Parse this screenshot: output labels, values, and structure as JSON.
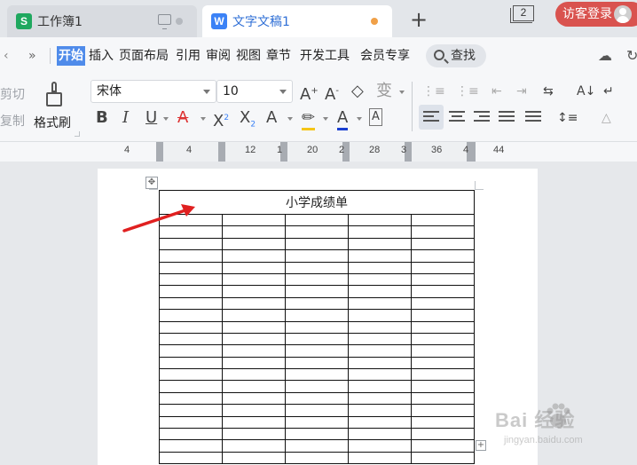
{
  "tabs": [
    {
      "label": "工作簿1",
      "logo": "S"
    },
    {
      "label": "文字文稿1",
      "logo": "W"
    }
  ],
  "new_tab_label": "+",
  "window_badge": "2",
  "guest_label": "访客登录",
  "menu": {
    "overflow": "»",
    "items": [
      "开始",
      "插入",
      "页面布局",
      "引用",
      "审阅",
      "视图",
      "章节",
      "开发工具",
      "会员专享"
    ],
    "search_label": "查找"
  },
  "clipboard": {
    "cut": "剪切",
    "copy": "复制",
    "format_painter": "格式刷"
  },
  "font": {
    "family": "宋体",
    "size": "10"
  },
  "ruler": {
    "numbers": [
      "4",
      "4",
      "12",
      "1",
      "20",
      "2",
      "28",
      "3",
      "36",
      "4",
      "44"
    ]
  },
  "table": {
    "title": "小学成绩单",
    "columns": 5,
    "rows": 21
  },
  "watermark": {
    "brand": "Bai  经验",
    "url": "jingyan.baidu.com"
  },
  "colors": {
    "accent": "#4f8bea",
    "guest": "#d9534f",
    "arrow": "#e02020",
    "tab_active_text": "#2f6fd6"
  }
}
